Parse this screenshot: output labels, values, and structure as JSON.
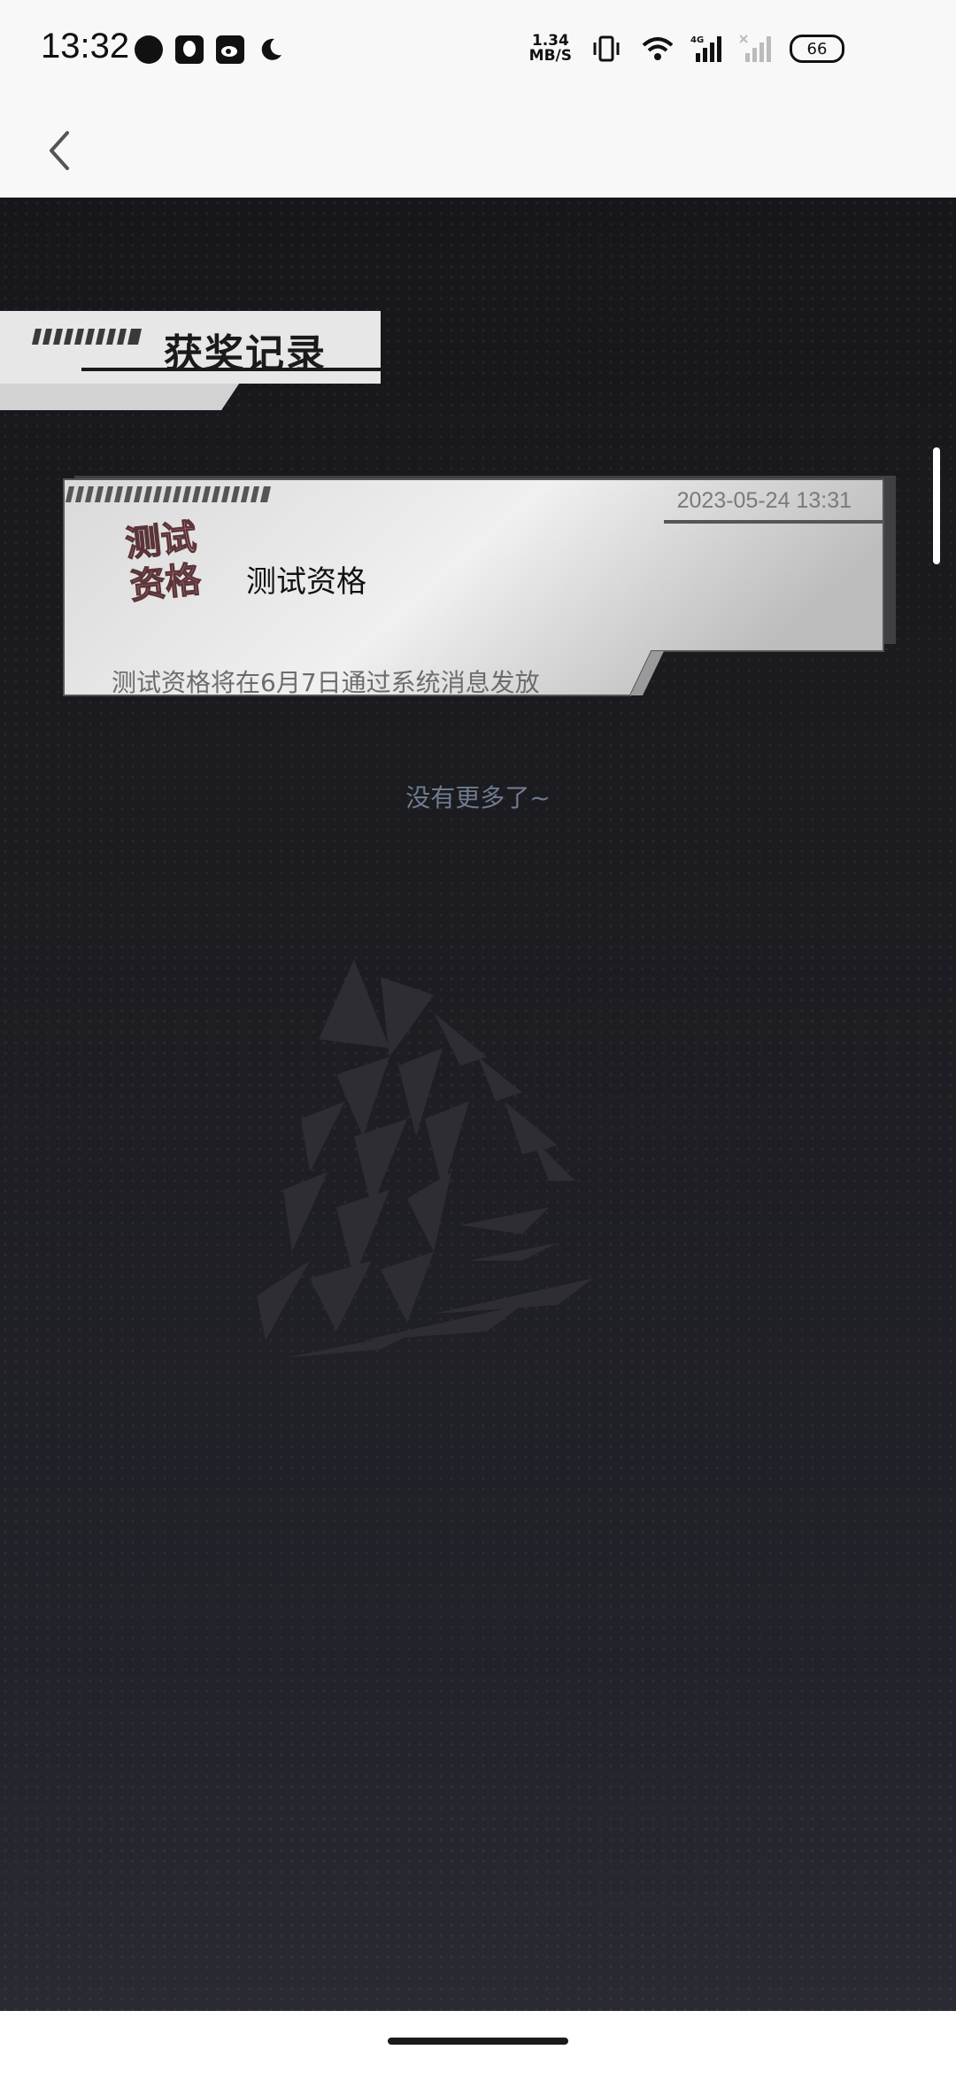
{
  "status_bar": {
    "time": "13:32",
    "net_speed_value": "1.34",
    "net_speed_unit": "MB/S",
    "network_type": "4G",
    "battery": "66"
  },
  "page": {
    "section_title": "获奖记录",
    "end_of_list": "没有更多了~"
  },
  "records": [
    {
      "date": "2023-05-24 13:31",
      "badge_line1": "测试",
      "badge_line2": "资格",
      "title": "测试资格",
      "description": "测试资格将在6月7日通过系统消息发放"
    }
  ],
  "colors": {
    "background_dark": "#17171b",
    "card_light": "#e9e9e9",
    "end_text": "#6f7c8e",
    "badge_pink": "#c9868f"
  },
  "icons": {
    "back": "chevron-left-icon",
    "status_left": [
      "message-icon",
      "qq-icon",
      "weibo-icon",
      "moon-icon"
    ],
    "status_right": [
      "vibrate-icon",
      "wifi-icon",
      "signal-icon",
      "signal-secondary-icon",
      "battery-icon"
    ]
  }
}
